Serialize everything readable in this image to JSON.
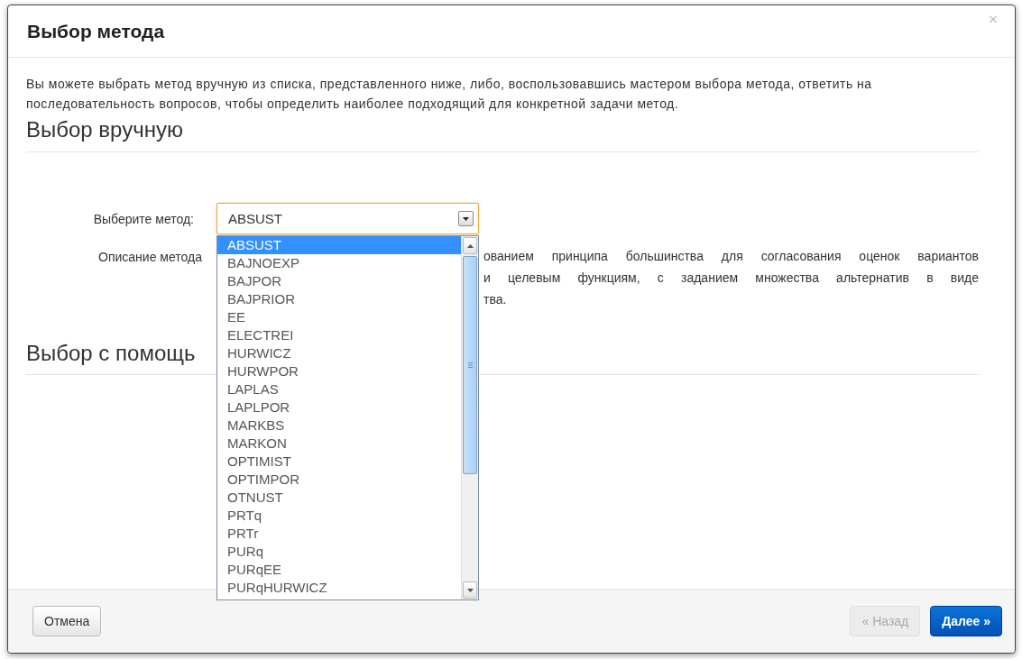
{
  "dialog": {
    "title": "Выбор метода",
    "close": "×",
    "intro": "Вы можете выбрать метод вручную из списка, представленного ниже, либо, воспользовавшись мастером выбора метода, ответить на последовательность вопросов, чтобы определить наиболее подходящий для конкретной задачи метод.",
    "manual_section": {
      "heading": "Выбор вручную",
      "method_label": "Выберите метод:",
      "method_value": "ABSUST",
      "options": [
        {
          "label": "ABSUST",
          "selected": true
        },
        {
          "label": "BAJNOEXP",
          "selected": false
        },
        {
          "label": "BAJPOR",
          "selected": false
        },
        {
          "label": "BAJPRIOR",
          "selected": false
        },
        {
          "label": "EE",
          "selected": false
        },
        {
          "label": "ELECTREI",
          "selected": false
        },
        {
          "label": "HURWICZ",
          "selected": false
        },
        {
          "label": "HURWPOR",
          "selected": false
        },
        {
          "label": "LAPLAS",
          "selected": false
        },
        {
          "label": "LAPLPOR",
          "selected": false
        },
        {
          "label": "MARKBS",
          "selected": false
        },
        {
          "label": "MARKON",
          "selected": false
        },
        {
          "label": "OPTIMIST",
          "selected": false
        },
        {
          "label": "OPTIMPOR",
          "selected": false
        },
        {
          "label": "OTNUST",
          "selected": false
        },
        {
          "label": "PRTq",
          "selected": false
        },
        {
          "label": "PRTr",
          "selected": false
        },
        {
          "label": "PURq",
          "selected": false
        },
        {
          "label": "PURqEE",
          "selected": false
        },
        {
          "label": "PURqHURWICZ",
          "selected": false
        }
      ],
      "description_label": "Описание метода",
      "description_lines": [
        "ованием принципа большинства для согласования оценок вариантов",
        "и целевым функциям, с заданием множества альтернатив в виде",
        "тва."
      ]
    },
    "wizard_section": {
      "heading": "Выбор с помощь"
    },
    "buttons": [
      {
        "label": "Отмена",
        "kind": "default",
        "disabled": false
      },
      {
        "label": "« Назад",
        "kind": "default",
        "disabled": true
      },
      {
        "label": "Далее »",
        "kind": "primary",
        "disabled": false
      }
    ]
  }
}
